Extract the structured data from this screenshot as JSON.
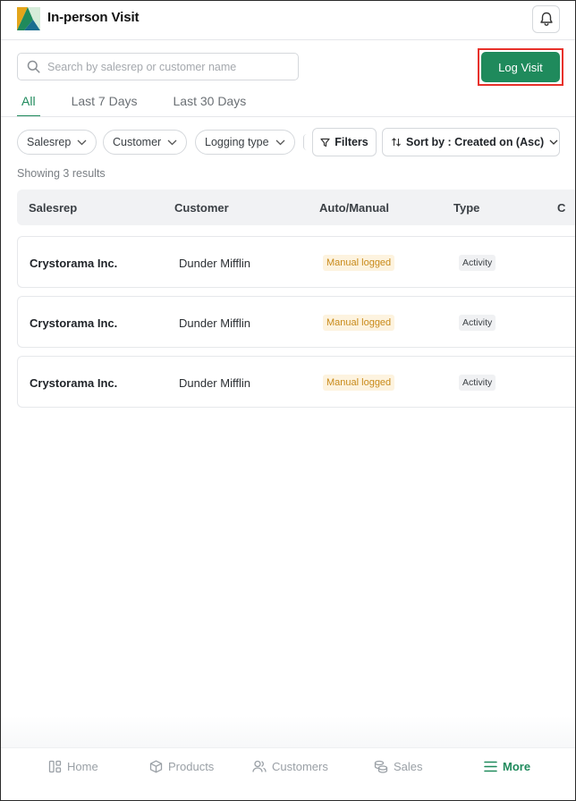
{
  "header": {
    "title": "In-person Visit",
    "logo_icon": "brand-logo-icon",
    "bell_icon": "bell-icon"
  },
  "search": {
    "placeholder": "Search by salesrep or customer name",
    "value": ""
  },
  "log_visit_label": "Log Visit",
  "tabs": [
    {
      "label": "All",
      "active": true
    },
    {
      "label": "Last 7 Days",
      "active": false
    },
    {
      "label": "Last 30 Days",
      "active": false
    }
  ],
  "filters": {
    "chips": [
      "Salesrep",
      "Customer",
      "Logging type"
    ],
    "filters_label": "Filters",
    "sort_label": "Sort by : Created on (Asc)"
  },
  "results_text": "Showing 3 results",
  "table": {
    "columns": [
      "Salesrep",
      "Customer",
      "Auto/Manual",
      "Type",
      "C"
    ],
    "rows": [
      {
        "salesrep": "Crystorama Inc.",
        "customer": "Dunder Mifflin",
        "mode": "Manual logged",
        "type": "Activity"
      },
      {
        "salesrep": "Crystorama Inc.",
        "customer": "Dunder Mifflin",
        "mode": "Manual logged",
        "type": "Activity"
      },
      {
        "salesrep": "Crystorama Inc.",
        "customer": "Dunder Mifflin",
        "mode": "Manual logged",
        "type": "Activity"
      }
    ]
  },
  "nav": [
    {
      "label": "Home",
      "icon": "home-icon",
      "active": false
    },
    {
      "label": "Products",
      "icon": "box-icon",
      "active": false
    },
    {
      "label": "Customers",
      "icon": "users-icon",
      "active": false
    },
    {
      "label": "Sales",
      "icon": "coins-icon",
      "active": false
    },
    {
      "label": "More",
      "icon": "menu-icon",
      "active": true
    }
  ],
  "colors": {
    "brand": "#1f8a5c",
    "highlight": "#e8312a",
    "manual_badge_bg": "#fdf3df",
    "manual_badge_text": "#c88a1a"
  }
}
